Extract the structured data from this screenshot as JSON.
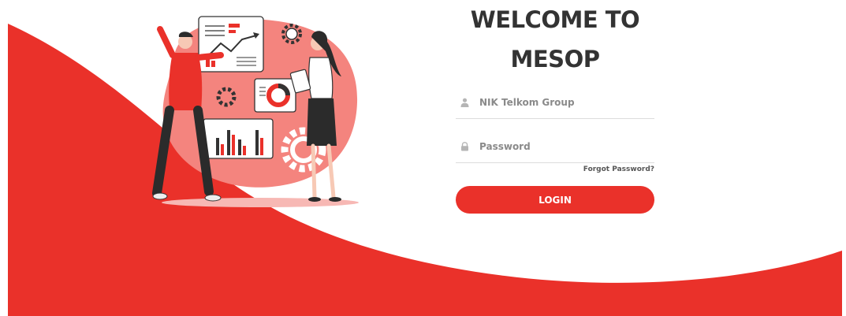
{
  "login": {
    "title_line1": "WELCOME TO",
    "title_line2": "MESOP",
    "username_placeholder": "NIK Telkom Group",
    "password_placeholder": "Password",
    "forgot_label": "Forgot Password?",
    "login_label": "LOGIN"
  },
  "icons": {
    "username": "user-icon",
    "password": "lock-icon"
  },
  "colors": {
    "brand_red": "#ea312a",
    "illustration_blob": "#f4847e",
    "title_text": "#333333"
  }
}
